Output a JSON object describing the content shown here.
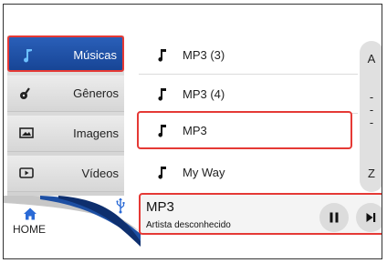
{
  "sidebar": {
    "items": [
      {
        "label": "Músicas",
        "icon": "music-note-icon",
        "active": true
      },
      {
        "label": "Gêneros",
        "icon": "guitar-icon",
        "active": false
      },
      {
        "label": "Imagens",
        "icon": "image-icon",
        "active": false
      },
      {
        "label": "Vídeos",
        "icon": "video-play-icon",
        "active": false
      }
    ]
  },
  "list": {
    "items": [
      {
        "label": "MP3 (3)",
        "selected": false
      },
      {
        "label": "MP3 (4)",
        "selected": false
      },
      {
        "label": "MP3",
        "selected": true
      },
      {
        "label": "My Way",
        "selected": false
      }
    ]
  },
  "alpha_index": {
    "top": "A",
    "middle": [
      "-",
      "-",
      "-"
    ],
    "bottom": "Z"
  },
  "bottom_bar": {
    "home_label": "HOME",
    "now_playing": {
      "title": "MP3",
      "artist": "Artista desconhecido"
    }
  },
  "colors": {
    "accent_blue": "#1e56b0",
    "highlight_red": "#e53935"
  }
}
